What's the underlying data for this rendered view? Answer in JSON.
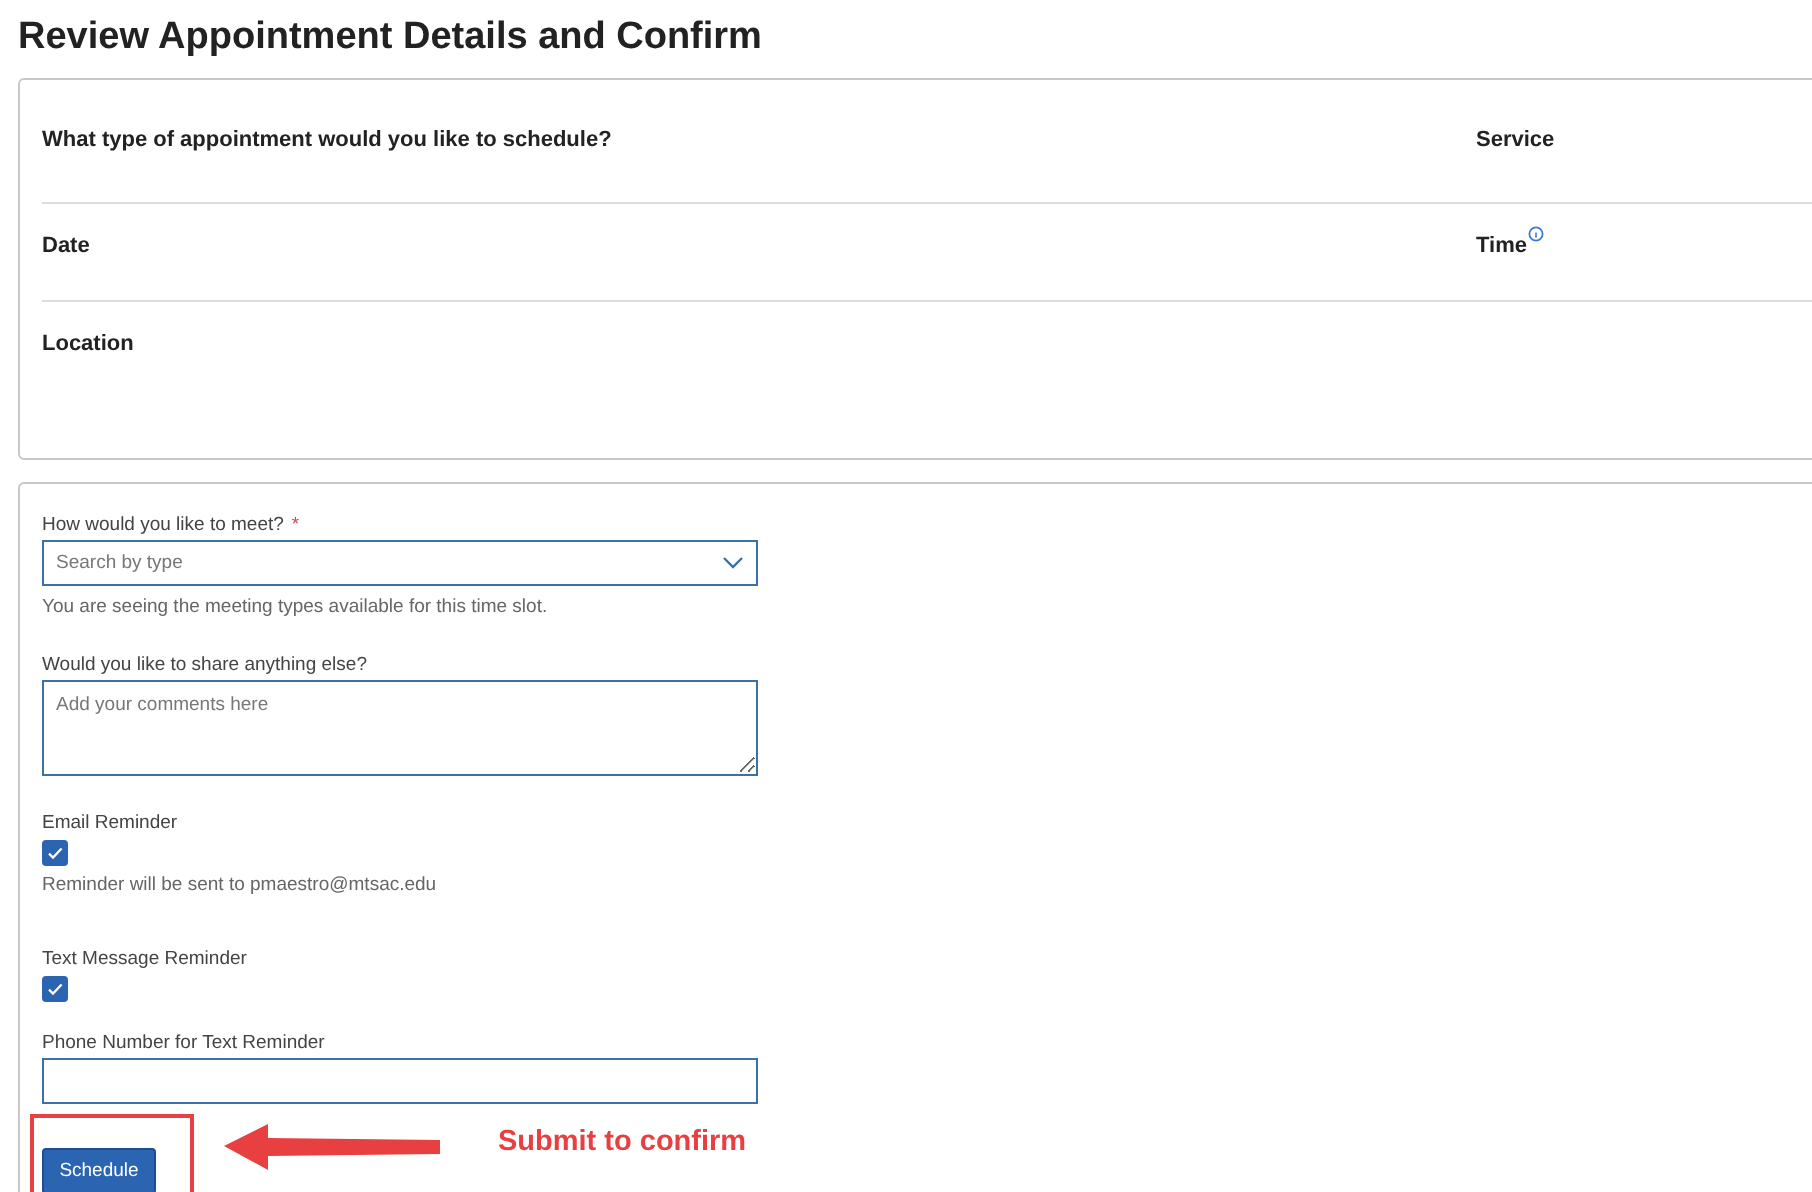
{
  "title": "Review Appointment Details and Confirm",
  "summary": {
    "rows": [
      {
        "left": {
          "label": "What type of appointment would you like to schedule?",
          "info": false
        },
        "right": {
          "label": "Service",
          "info": false
        }
      },
      {
        "left": {
          "label": "Date",
          "info": false
        },
        "right": {
          "label": "Time",
          "info": true
        }
      },
      {
        "left": {
          "label": "Location",
          "info": false
        }
      }
    ]
  },
  "form": {
    "meet": {
      "label": "How would you like to meet?",
      "required_mark": "*",
      "placeholder": "Search by type",
      "help": "You are seeing the meeting types available for this time slot."
    },
    "comments": {
      "label": "Would you like to share anything else?",
      "placeholder": "Add your comments here"
    },
    "reminders": [
      {
        "label": "Email Reminder",
        "checked": true,
        "note": "Reminder will be sent to pmaestro@mtsac.edu"
      },
      {
        "label": "Text Message Reminder",
        "checked": true
      }
    ],
    "phone": {
      "label": "Phone Number for Text Reminder"
    },
    "submit": "Schedule"
  },
  "annotation": {
    "text": "Submit to confirm"
  }
}
